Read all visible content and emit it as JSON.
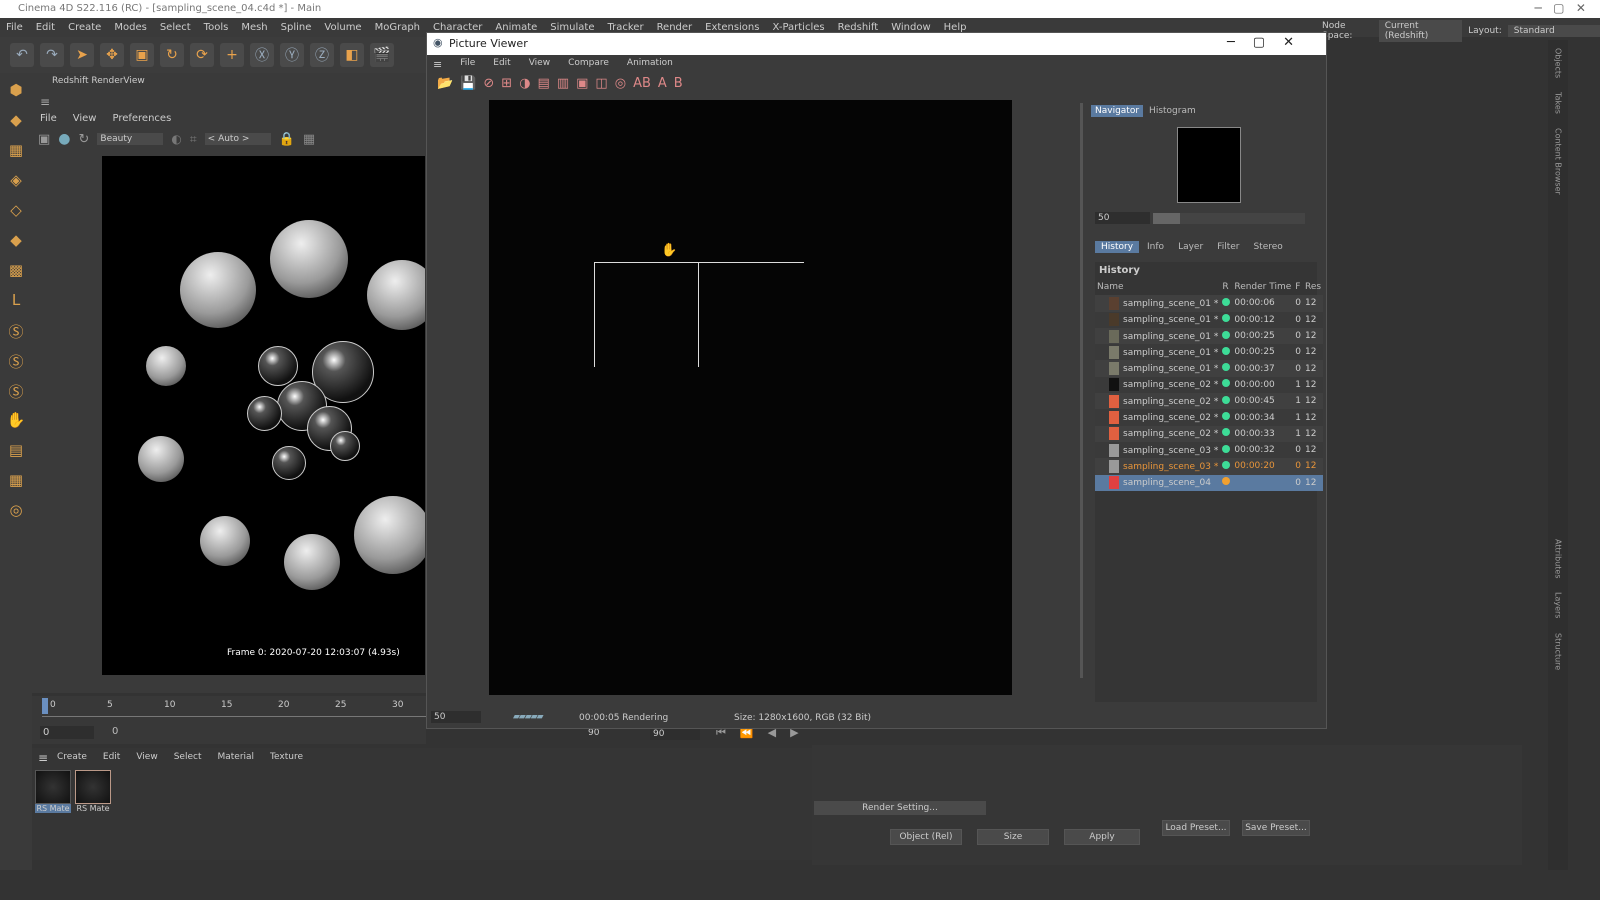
{
  "app": {
    "title": "Cinema 4D S22.116 (RC) - [sampling_scene_04.c4d *] - Main",
    "menu": [
      "File",
      "Edit",
      "Create",
      "Modes",
      "Select",
      "Tools",
      "Mesh",
      "Spline",
      "Volume",
      "MoGraph",
      "Character",
      "Animate",
      "Simulate",
      "Tracker",
      "Render",
      "Extensions",
      "X-Particles",
      "Redshift",
      "Window",
      "Help"
    ],
    "node_space_label": "Node Space:",
    "node_space_value": "Current (Redshift)",
    "layout_label": "Layout:",
    "layout_value": "Standard"
  },
  "renderview": {
    "title": "Redshift RenderView",
    "menu": [
      "File",
      "View",
      "Preferences"
    ],
    "aov": "Beauty",
    "auto": "< Auto >",
    "frame_info": "Frame  0:  2020-07-20  12:03:07  (4.93s)"
  },
  "timeline": {
    "ticks": [
      "0",
      "5",
      "10",
      "15",
      "20",
      "25",
      "30"
    ],
    "start": "0",
    "current": "0",
    "end": "90",
    "end2": "90"
  },
  "materials": {
    "menu": [
      "Create",
      "Edit",
      "View",
      "Select",
      "Material",
      "Texture"
    ],
    "items": [
      "RS Mate",
      "RS Mate"
    ]
  },
  "picture_viewer": {
    "title": "Picture Viewer",
    "menu": [
      "File",
      "Edit",
      "View",
      "Compare",
      "Animation"
    ],
    "nav_tabs": [
      "Navigator",
      "Histogram"
    ],
    "zoom": "50",
    "tabs": [
      "History",
      "Info",
      "Layer",
      "Filter",
      "Stereo"
    ],
    "history_title": "History",
    "columns": [
      "Name",
      "R",
      "Render Time",
      "F",
      "Res"
    ],
    "rows": [
      {
        "name": "sampling_scene_01 *",
        "time": "00:00:06",
        "f": "0",
        "res": "12",
        "thumb": "#5a4030",
        "status": "#3ddc97"
      },
      {
        "name": "sampling_scene_01 *",
        "time": "00:00:12",
        "f": "0",
        "res": "12",
        "thumb": "#4a3a2a",
        "status": "#3ddc97"
      },
      {
        "name": "sampling_scene_01 *",
        "time": "00:00:25",
        "f": "0",
        "res": "12",
        "thumb": "#6a6a5a",
        "status": "#3ddc97"
      },
      {
        "name": "sampling_scene_01 *",
        "time": "00:00:25",
        "f": "0",
        "res": "12",
        "thumb": "#7a7a6a",
        "status": "#3ddc97"
      },
      {
        "name": "sampling_scene_01 *",
        "time": "00:00:37",
        "f": "0",
        "res": "12",
        "thumb": "#7a7a6a",
        "status": "#3ddc97"
      },
      {
        "name": "sampling_scene_02 *",
        "time": "00:00:00",
        "f": "1",
        "res": "12",
        "thumb": "#111111",
        "status": "#3ddc97"
      },
      {
        "name": "sampling_scene_02 *",
        "time": "00:00:45",
        "f": "1",
        "res": "12",
        "thumb": "#e06040",
        "status": "#3ddc97"
      },
      {
        "name": "sampling_scene_02 *",
        "time": "00:00:34",
        "f": "1",
        "res": "12",
        "thumb": "#e06040",
        "status": "#3ddc97"
      },
      {
        "name": "sampling_scene_02 *",
        "time": "00:00:33",
        "f": "1",
        "res": "12",
        "thumb": "#e06040",
        "status": "#3ddc97"
      },
      {
        "name": "sampling_scene_03 *",
        "time": "00:00:32",
        "f": "0",
        "res": "12",
        "thumb": "#999999",
        "status": "#3ddc97"
      },
      {
        "name": "sampling_scene_03 *",
        "time": "00:00:20",
        "f": "0",
        "res": "12",
        "thumb": "#999999",
        "status": "#3ddc97",
        "highlight": "#e8953a"
      },
      {
        "name": "sampling_scene_04",
        "time": "",
        "f": "0",
        "res": "12",
        "thumb": "#e04040",
        "status": "#f0a030",
        "selected": true
      }
    ],
    "status_zoom": "50",
    "status_text": "00:00:05 Rendering",
    "size_info": "Size: 1280x1600, RGB (32 Bit)"
  },
  "attributes": {
    "render_setting": "Render Setting...",
    "load_preset": "Load Preset...",
    "save_preset": "Save Preset...",
    "coord_mode": "Object (Rel)",
    "size_mode": "Size",
    "apply": "Apply"
  },
  "side_tabs": [
    "Objects",
    "Takes",
    "Content Browser",
    "Attributes",
    "Layers",
    "Structure"
  ],
  "colors": {
    "accent": "#5a7aa0",
    "ok": "#3ddc97",
    "rendering": "#f0a030"
  }
}
